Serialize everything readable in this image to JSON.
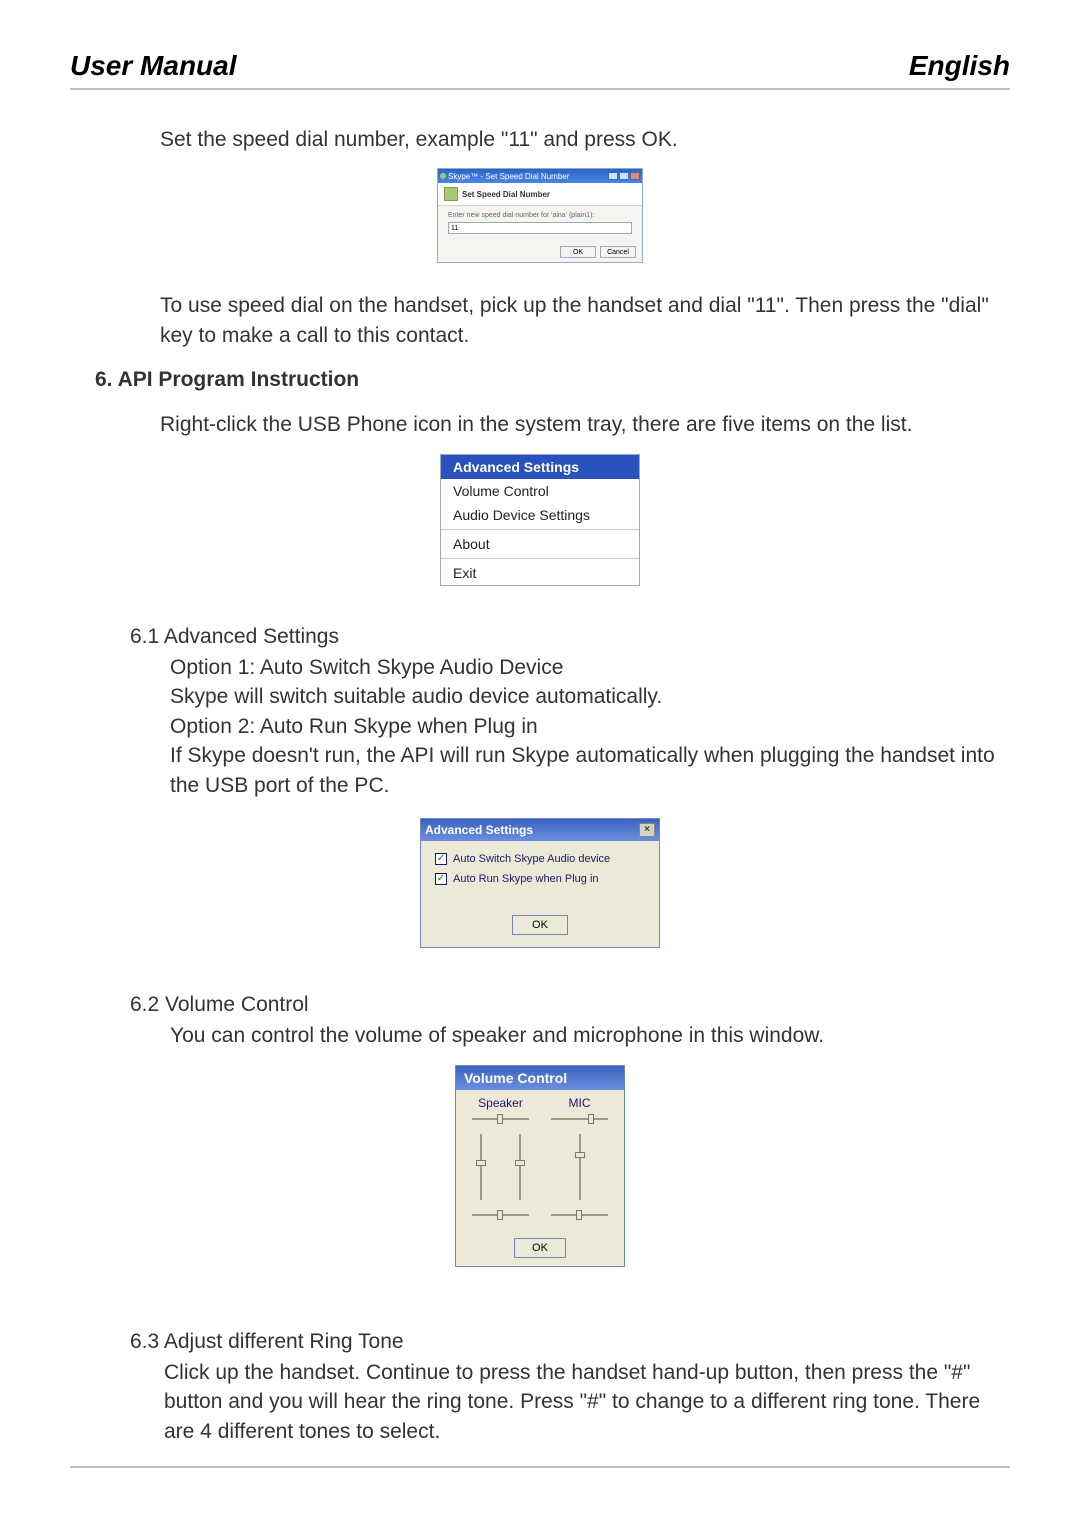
{
  "header": {
    "left": "User Manual",
    "right": "English"
  },
  "p1": "Set the speed dial number, example \"11\" and press OK.",
  "dlg_speed": {
    "title": "Skype™ - Set Speed Dial Number",
    "heading": "Set Speed Dial Number",
    "prompt": "Enter new speed dial number for 'aina' (plain1):",
    "value": "11",
    "ok": "OK",
    "cancel": "Cancel"
  },
  "p2": "To use speed dial on the handset, pick up the handset and dial \"11\". Then press the \"dial\" key to make a call to this contact.",
  "section6": "6. API Program Instruction",
  "p3": "Right-click the USB Phone icon in the system tray, there are five items on the list.",
  "menu": {
    "items": [
      "Advanced Settings",
      "Volume Control",
      "Audio Device Settings",
      "About",
      "Exit"
    ]
  },
  "s61": {
    "num": "6.1  Advanced Settings",
    "l1": "Option 1: Auto Switch Skype Audio Device",
    "l2": "Skype will switch suitable audio device automatically.",
    "l3": "Option 2: Auto Run Skype when Plug in",
    "l4": "If Skype doesn't run, the API will run Skype automatically when plugging the handset into the USB port of the PC."
  },
  "dlg_adv": {
    "title": "Advanced Settings",
    "opt1": "Auto Switch Skype Audio device",
    "opt2": "Auto Run Skype when Plug in",
    "ok": "OK"
  },
  "s62": {
    "num": "6.2  Volume Control",
    "l1": "You can control the volume of speaker and microphone in this window."
  },
  "dlg_vol": {
    "title": "Volume Control",
    "speaker": "Speaker",
    "mic": "MIC",
    "ok": "OK"
  },
  "s63": {
    "num": "6.3  Adjust different Ring Tone",
    "l1": "Click up the handset. Continue to press the handset hand-up button, then press the \"#\" button and you will hear the ring tone. Press \"#\" to change to a different ring tone. There are 4 different tones to select."
  }
}
